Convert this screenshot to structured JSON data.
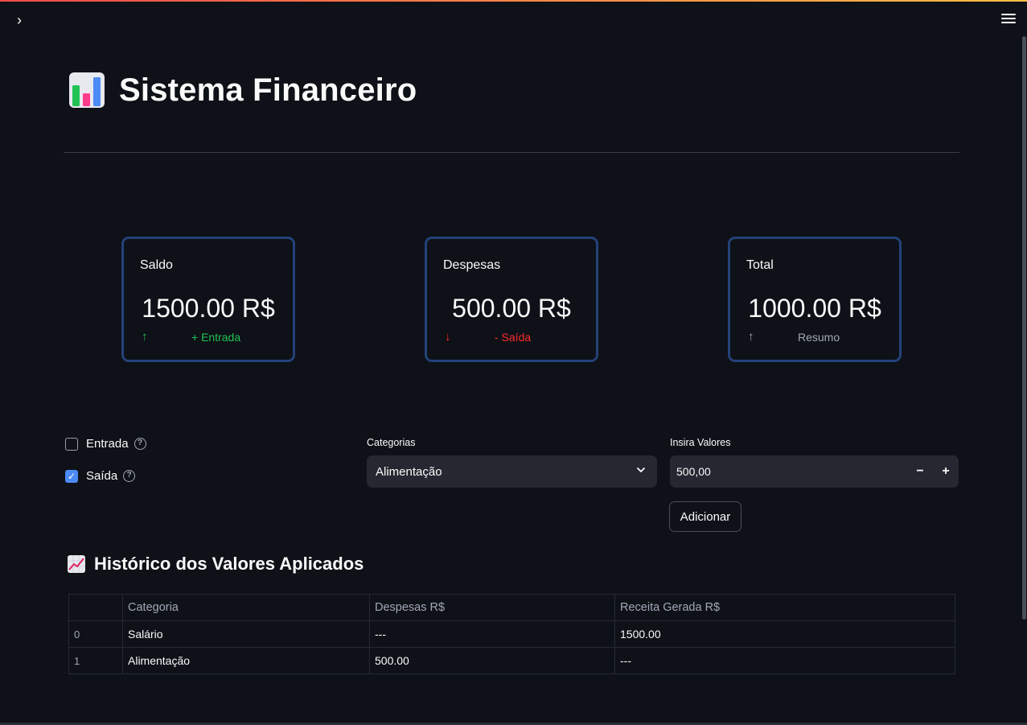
{
  "app": {
    "title": "Sistema Financeiro",
    "title_icon": "bar-chart-emoji-icon",
    "sidebar_toggle_icon": "chevron-right-icon",
    "menu_icon": "hamburger-menu-icon"
  },
  "metrics": [
    {
      "label": "Saldo",
      "value": "1500.00 R$",
      "delta": "+ Entrada",
      "arrow": "↑",
      "color": "#21c354"
    },
    {
      "label": "Despesas",
      "value": "500.00 R$",
      "delta": "- Saída",
      "arrow": "↓",
      "color": "#ff2b2b"
    },
    {
      "label": "Total",
      "value": "1000.00 R$",
      "delta": "Resumo",
      "arrow": "↑",
      "color": "#a3a8b8"
    }
  ],
  "form": {
    "entrada_label": "Entrada",
    "entrada_checked": false,
    "saida_label": "Saída",
    "saida_checked": true,
    "categorias_label": "Categorias",
    "categorias_selected": "Alimentação",
    "valores_label": "Insira Valores",
    "valores_value": "500,00",
    "minus_label": "−",
    "plus_label": "+",
    "add_button": "Adicionar"
  },
  "history": {
    "title": "Histórico dos Valores Aplicados",
    "icon": "chart-increasing-emoji-icon",
    "columns": [
      "",
      "Categoria",
      "Despesas R$",
      "Receita Gerada R$"
    ],
    "rows": [
      {
        "index": "0",
        "categoria": "Salário",
        "despesas": "---",
        "receita": "1500.00"
      },
      {
        "index": "1",
        "categoria": "Alimentação",
        "despesas": "500.00",
        "receita": "---"
      }
    ]
  },
  "colors": {
    "background": "#0e1117",
    "card_border": "#23427a",
    "input_bg": "#262730",
    "checkbox_checked": "#4c8bf5",
    "positive": "#21c354",
    "negative": "#ff2b2b"
  }
}
